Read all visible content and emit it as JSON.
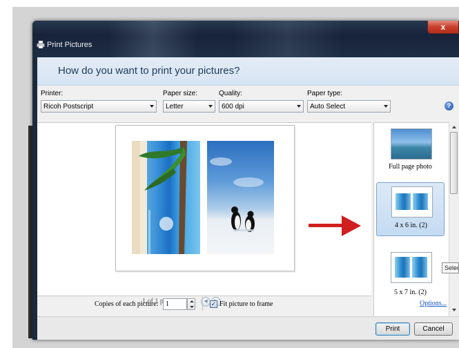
{
  "window": {
    "title": "Print Pictures",
    "close_glyph": "x"
  },
  "header": {
    "question": "How do you want to print your pictures?"
  },
  "controls": {
    "printer": {
      "label": "Printer:",
      "value": "Ricoh Postscript"
    },
    "paper_size": {
      "label": "Paper size:",
      "value": "Letter"
    },
    "quality": {
      "label": "Quality:",
      "value": "600 dpi"
    },
    "paper_type": {
      "label": "Paper type:",
      "value": "Auto Select"
    },
    "help_glyph": "?"
  },
  "preview": {
    "page_text": "1 of 1 page",
    "prev_glyph": "◀",
    "next_glyph": "▶"
  },
  "layouts": [
    {
      "label": "Full page photo",
      "selected": false
    },
    {
      "label": "4 x 6 in. (2)",
      "selected": true
    },
    {
      "label": "5 x 7 in. (2)",
      "selected": false
    }
  ],
  "tooltip": "Select",
  "copies": {
    "label": "Copies of each picture:",
    "value": "1"
  },
  "fit": {
    "label": "Fit picture to frame",
    "checked": true,
    "check_glyph": "✓"
  },
  "options_link": "Options...",
  "buttons": {
    "print": "Print",
    "cancel": "Cancel"
  },
  "colors": {
    "arrow": "#d11f1f",
    "link": "#1558c0",
    "header_band": "#dce8f5",
    "close_button": "#c8402c"
  }
}
